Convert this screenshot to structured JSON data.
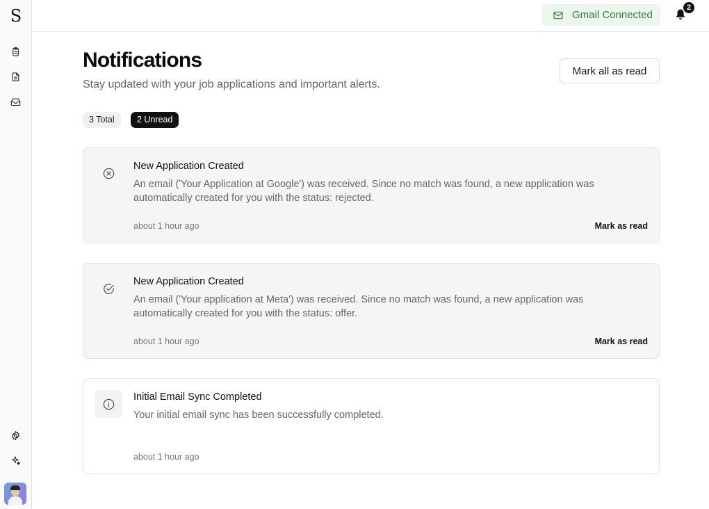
{
  "sidebar": {
    "logo": "S",
    "items": [
      {
        "icon": "clipboard-icon"
      },
      {
        "icon": "document-icon"
      },
      {
        "icon": "inbox-icon"
      }
    ],
    "bottom_items": [
      {
        "icon": "gear-icon"
      },
      {
        "icon": "sparkles-icon"
      }
    ]
  },
  "topbar": {
    "gmail_status": "Gmail Connected",
    "gmail_color": "#2e7d3a",
    "notification_count": "2"
  },
  "header": {
    "title": "Notifications",
    "subtitle": "Stay updated with your job applications and important alerts.",
    "mark_all_label": "Mark all as read"
  },
  "counts": {
    "total": "3 Total",
    "unread": "2 Unread"
  },
  "notifications": [
    {
      "icon": "x-circle-icon",
      "title": "New Application Created",
      "body": "An email ('Your Application at Google') was received. Since no match was found, a new application was automatically created for you with the status: rejected.",
      "time": "about 1 hour ago",
      "action": "Mark as read",
      "unread": true
    },
    {
      "icon": "check-circle-icon",
      "title": "New Application Created",
      "body": "An email ('Your application at Meta') was received. Since no match was found, a new application was automatically created for you with the status: offer.",
      "time": "about 1 hour ago",
      "action": "Mark as read",
      "unread": true
    },
    {
      "icon": "info-icon",
      "title": "Initial Email Sync Completed",
      "body": "Your initial email sync has been successfully completed.",
      "time": "about 1 hour ago",
      "unread": false
    }
  ]
}
